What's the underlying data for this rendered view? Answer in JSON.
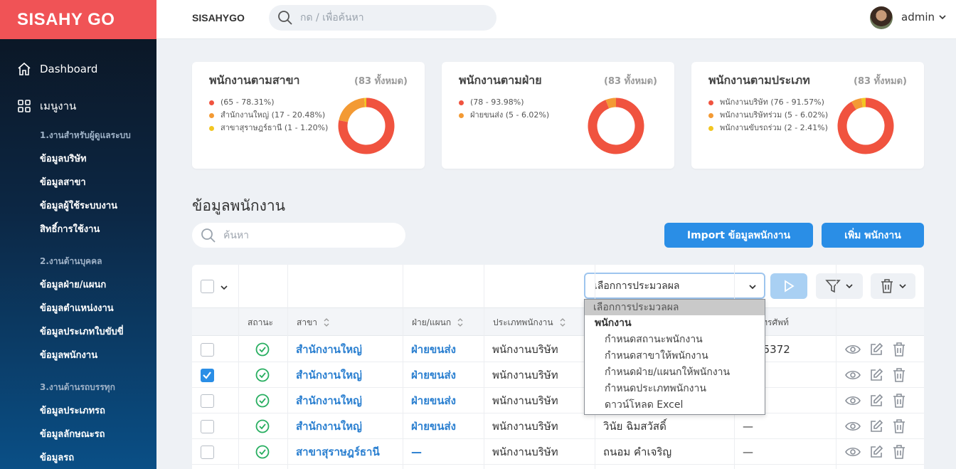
{
  "brand": "SISAHY GO",
  "topbar": {
    "app_name": "SISAHYGO",
    "search_placeholder": "กด / เพื่อค้นหา",
    "user": "admin"
  },
  "sidebar": {
    "dashboard": "Dashboard",
    "menu": "เมนูงาน",
    "sections": [
      {
        "title": "1.งานสำหรับผู้ดูแลระบบ",
        "items": [
          "ข้อมูลบริษัท",
          "ข้อมูลสาขา",
          "ข้อมูลผู้ใช้ระบบงาน",
          "สิทธิ์การใช้งาน"
        ]
      },
      {
        "title": "2.งานด้านบุคคล",
        "items": [
          "ข้อมูลฝ่าย/แผนก",
          "ข้อมูลตำแหน่งงาน",
          "ข้อมูลประเภทใบขับขี่",
          "ข้อมูลพนักงาน"
        ]
      },
      {
        "title": "3.งานด้านรถบรรทุก",
        "items": [
          "ข้อมูลประเภทรถ",
          "ข้อมูลลักษณะรถ",
          "ข้อมูลรถ"
        ]
      }
    ]
  },
  "cards": [
    {
      "title": "พนักงานตามสาขา",
      "total": "(83 ทั้งหมด)",
      "legend": [
        "(65 - 78.31%)",
        "สำนักงานใหญ่ (17 - 20.48%)",
        "สาขาสุราษฎร์ธานี (1 - 1.20%)"
      ]
    },
    {
      "title": "พนักงานตามฝ่าย",
      "total": "(83 ทั้งหมด)",
      "legend": [
        "(78 - 93.98%)",
        "ฝ่ายขนส่ง (5 - 6.02%)"
      ]
    },
    {
      "title": "พนักงานตามประเภท",
      "total": "(83 ทั้งหมด)",
      "legend": [
        "พนักงานบริษัท (76 - 91.57%)",
        "พนักงานบริษัทร่วม (5 - 6.02%)",
        "พนักงานขับรถร่วม (2 - 2.41%)"
      ]
    }
  ],
  "chart_data": [
    {
      "type": "pie",
      "title": "พนักงานตามสาขา",
      "categories": [
        "",
        "สำนักงานใหญ่",
        "สาขาสุราษฎร์ธานี"
      ],
      "values": [
        65,
        17,
        1
      ],
      "colors": [
        "#f0533f",
        "#f39a34",
        "#f2c621"
      ]
    },
    {
      "type": "pie",
      "title": "พนักงานตามฝ่าย",
      "categories": [
        "",
        "ฝ่ายขนส่ง"
      ],
      "values": [
        78,
        5
      ],
      "colors": [
        "#f0533f",
        "#f39a34"
      ]
    },
    {
      "type": "pie",
      "title": "พนักงานตามประเภท",
      "categories": [
        "พนักงานบริษัท",
        "พนักงานบริษัทร่วม",
        "พนักงานขับรถร่วม"
      ],
      "values": [
        76,
        5,
        2
      ],
      "colors": [
        "#f0533f",
        "#f39a34",
        "#f2c621"
      ]
    }
  ],
  "section_title": "ข้อมูลพนักงาน",
  "list_search_placeholder": "ค้นหา",
  "buttons": {
    "import": "Import ข้อมูลพนักงาน",
    "add": "เพิ่ม พนักงาน"
  },
  "process_select": {
    "value": "เลือกการประมวลผล"
  },
  "dropdown": {
    "selected": "เลือกการประมวลผล",
    "group": "พนักงาน",
    "options": [
      "กำหนดสถานะพนักงาน",
      "กำหนดสาขาให้พนักงาน",
      "กำหนดฝ่าย/แผนกให้พนักงาน",
      "กำหนดประเภทพนักงาน",
      "ดาวน์โหลด Excel"
    ]
  },
  "table": {
    "headers": [
      "สถานะ",
      "สาขา",
      "ฝ่าย/แผนก",
      "ประเภทพนักงาน",
      "",
      "เลขโทรศัพท์"
    ],
    "rows": [
      {
        "checked": false,
        "branch": "สำนักงานใหญ่",
        "dept": "ฝ่ายขนส่ง",
        "type": "พนักงานบริษัท",
        "name": "",
        "phone": "6775372"
      },
      {
        "checked": true,
        "branch": "สำนักงานใหญ่",
        "dept": "ฝ่ายขนส่ง",
        "type": "พนักงานบริษัท",
        "name": "",
        "phone": ""
      },
      {
        "checked": false,
        "branch": "สำนักงานใหญ่",
        "dept": "ฝ่ายขนส่ง",
        "type": "พนักงานบริษัท",
        "name": "",
        "phone": ""
      },
      {
        "checked": false,
        "branch": "สำนักงานใหญ่",
        "dept": "ฝ่ายขนส่ง",
        "type": "พนักงานบริษัท",
        "name": "วินัย ฉิมสวัสดิ์",
        "phone": "—"
      },
      {
        "checked": false,
        "branch": "สาขาสุราษฎร์ธานี",
        "dept": "—",
        "type": "พนักงานบริษัท",
        "name": "ถนอม คำเจริญ",
        "phone": "—"
      }
    ]
  },
  "colors": {
    "brand": "#f05356",
    "accent": "#2a8ee6",
    "link": "#2a7fd0",
    "status_ok": "#27ae60"
  }
}
